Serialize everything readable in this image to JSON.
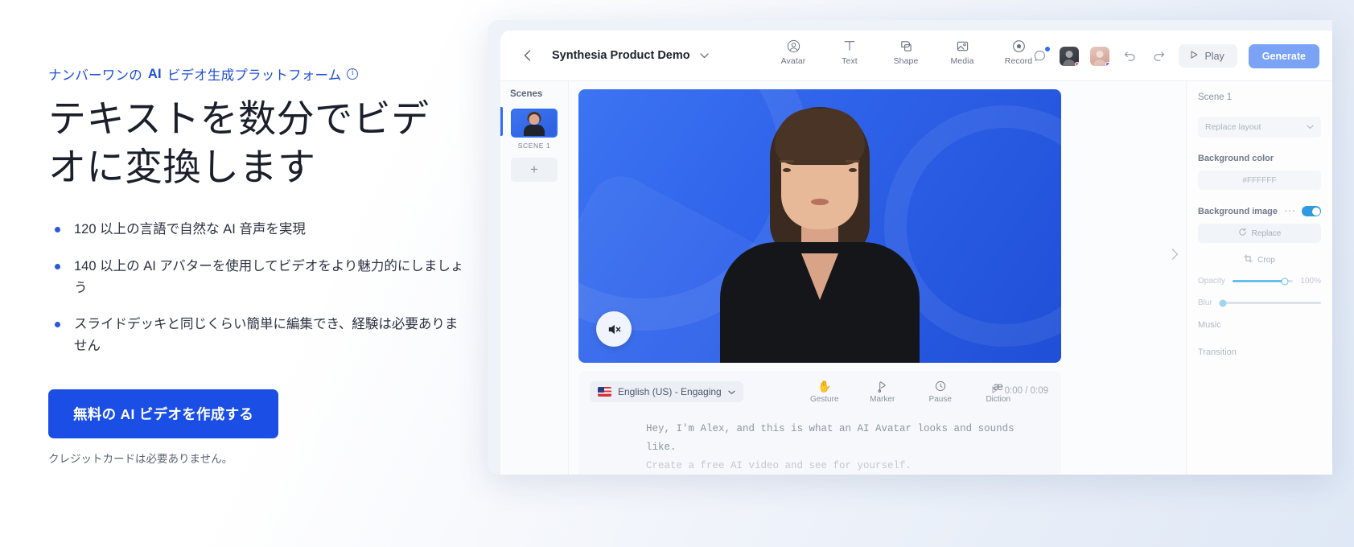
{
  "hero": {
    "eyebrow_pre": "ナンバーワンの ",
    "eyebrow_strong": "AI",
    "eyebrow_post": " ビデオ生成プラットフォーム",
    "headline": "テキストを数分でビデオに変換します",
    "bullets": [
      "120 以上の言語で自然な AI 音声を実現",
      "140 以上の AI アバターを使用してビデオをより魅力的にしましょう",
      "スライドデッキと同じくらい簡単に編集でき、経験は必要ありません"
    ],
    "cta_label": "無料の AI ビデオを作成する",
    "disclaimer": "クレジットカードは必要ありません。",
    "accent_color": "#1b4ee5",
    "eyebrow_color": "#1f4fd8"
  },
  "app": {
    "topbar": {
      "back_icon": "chevron-left-icon",
      "doc_title": "Synthesia Product Demo",
      "title_chevron": "chevron-down-icon",
      "tools": [
        {
          "label": "Avatar",
          "icon": "avatar-icon"
        },
        {
          "label": "Text",
          "icon": "text-icon"
        },
        {
          "label": "Shape",
          "icon": "shape-icon"
        },
        {
          "label": "Media",
          "icon": "media-icon"
        },
        {
          "label": "Record",
          "icon": "record-icon"
        }
      ],
      "comment_icon": "comment-icon",
      "collab_avatars": [
        "collaborator-1",
        "collaborator-2"
      ],
      "undo_icon": "undo-icon",
      "redo_icon": "redo-icon",
      "play_label": "Play",
      "play_icon": "play-icon",
      "generate_label": "Generate"
    },
    "scenes": {
      "title": "Scenes",
      "scene_label": "SCENE 1",
      "add_label": "+"
    },
    "scriptbar": {
      "language": "English (US) - Engaging",
      "language_flag": "us-flag-icon",
      "lang_chevron": "chevron-down-icon",
      "tools": [
        {
          "label": "Gesture",
          "icon": "gesture-icon",
          "glyph": "✋"
        },
        {
          "label": "Marker",
          "icon": "marker-icon",
          "glyph": "⚲"
        },
        {
          "label": "Pause",
          "icon": "pause-clock-icon",
          "glyph": "◷"
        },
        {
          "label": "Diction",
          "icon": "diction-icon",
          "glyph": "æ"
        }
      ],
      "timecode": "0:00 / 0:09",
      "timecode_icon": "play-small-icon",
      "script_line_1": "Hey, I'm Alex, and this is what an AI Avatar looks and sounds like.",
      "script_line_2": "Create a free AI video and see for yourself."
    },
    "canvas": {
      "mute_icon": "speaker-muted-icon"
    },
    "right_panel": {
      "scene_title": "Scene 1",
      "replace_layout": "Replace layout",
      "background_color_label": "Background color",
      "background_color_value": "#FFFFFF",
      "background_image_label": "Background image",
      "background_image_dots": "···",
      "replace_label": "Replace",
      "replace_icon": "refresh-icon",
      "crop_label": "Crop",
      "crop_icon": "crop-icon",
      "opacity_label": "Opacity",
      "opacity_value": "100%",
      "blur_label": "Blur",
      "music_label": "Music",
      "transition_label": "Transition",
      "toggle_on": true,
      "toggle_color": "#2f9ae0",
      "collapse_icon": "chevron-right-icon"
    }
  }
}
